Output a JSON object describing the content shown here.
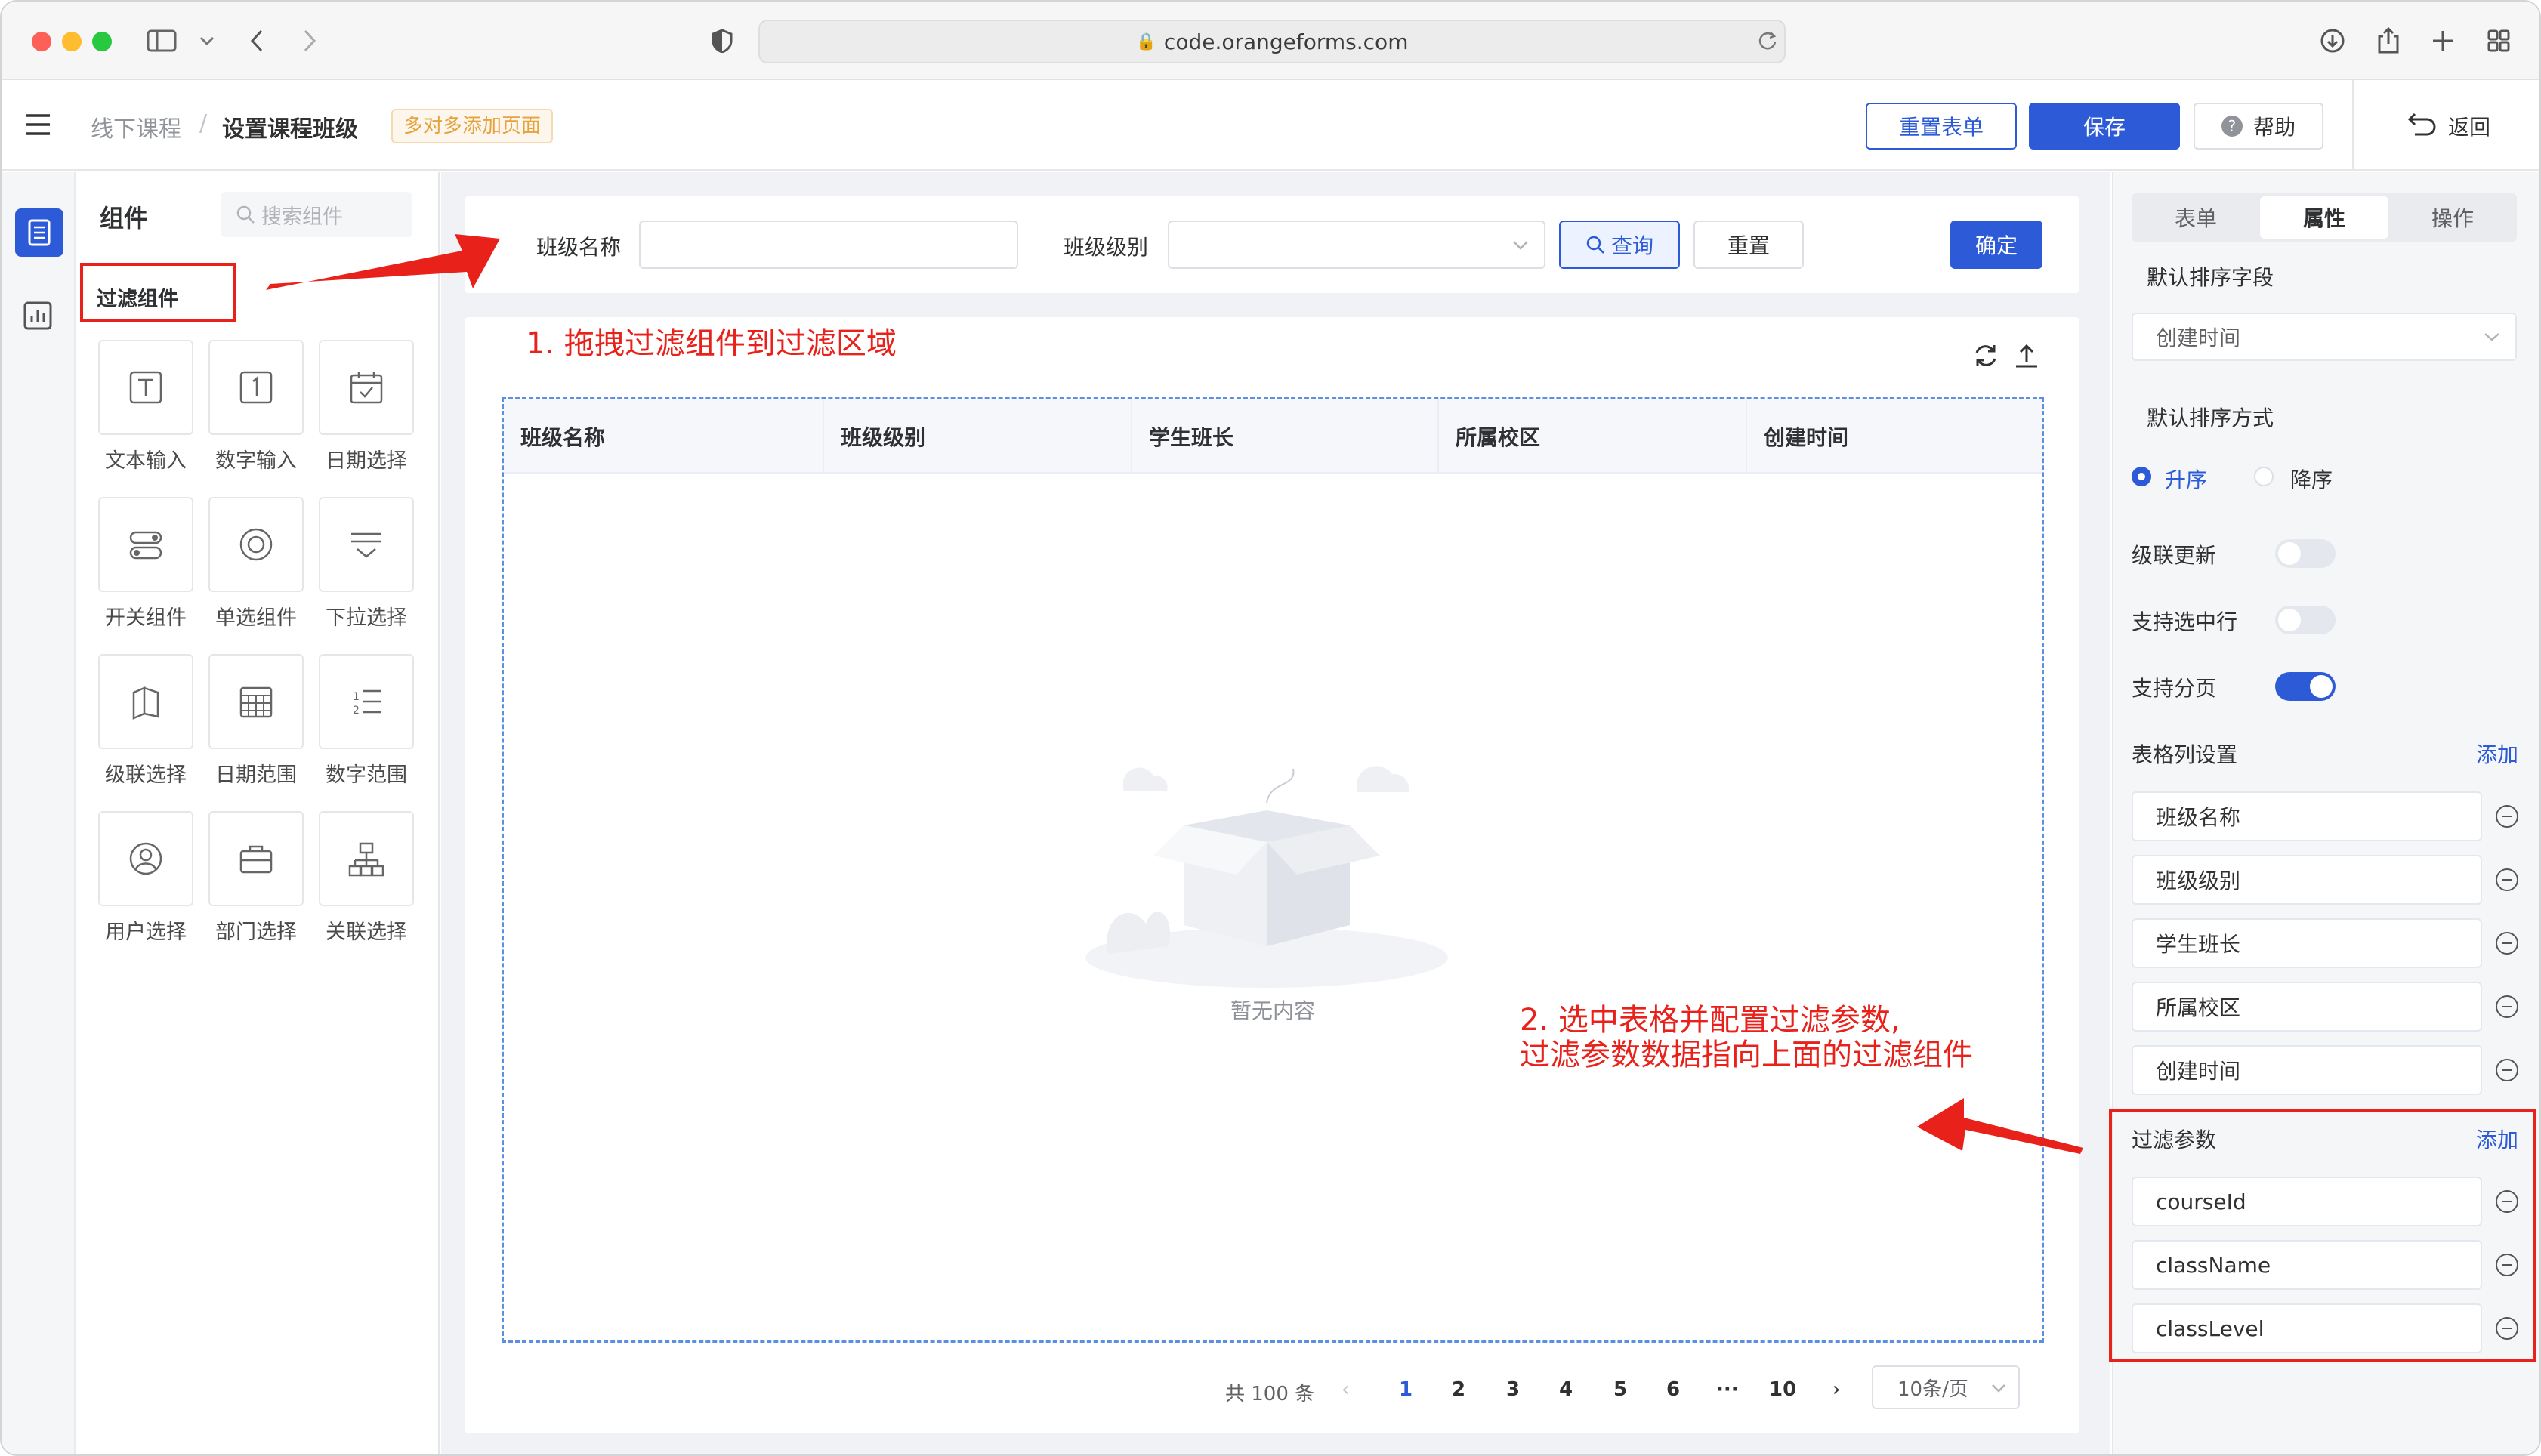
{
  "browser": {
    "url": "code.orangeforms.com"
  },
  "header": {
    "breadcrumb": [
      "线下课程",
      "设置课程班级"
    ],
    "tag": "多对多添加页面",
    "reset_form_button": "重置表单",
    "save_button": "保存",
    "help_button": "帮助",
    "back_button": "返回"
  },
  "palette": {
    "title": "组件",
    "search_placeholder": "搜索组件",
    "section_title": "过滤组件",
    "items": [
      {
        "label": "文本输入",
        "icon": "text-input-icon"
      },
      {
        "label": "数字输入",
        "icon": "number-input-icon"
      },
      {
        "label": "日期选择",
        "icon": "date-picker-icon"
      },
      {
        "label": "开关组件",
        "icon": "switch-icon"
      },
      {
        "label": "单选组件",
        "icon": "radio-icon"
      },
      {
        "label": "下拉选择",
        "icon": "select-icon"
      },
      {
        "label": "级联选择",
        "icon": "cascader-icon"
      },
      {
        "label": "日期范围",
        "icon": "date-range-icon"
      },
      {
        "label": "数字范围",
        "icon": "number-range-icon"
      },
      {
        "label": "用户选择",
        "icon": "user-select-icon"
      },
      {
        "label": "部门选择",
        "icon": "dept-select-icon"
      },
      {
        "label": "关联选择",
        "icon": "relation-select-icon"
      }
    ]
  },
  "filter": {
    "class_name_label": "班级名称",
    "class_level_label": "班级级别",
    "query_button": "查询",
    "reset_button": "重置",
    "confirm_button": "确定"
  },
  "table": {
    "columns": [
      "班级名称",
      "班级级别",
      "学生班长",
      "所属校区",
      "创建时间"
    ],
    "empty_text": "暂无内容"
  },
  "pagination": {
    "total": "共 100 条",
    "pages": [
      "1",
      "2",
      "3",
      "4",
      "5",
      "6",
      "···",
      "10"
    ],
    "current": "1",
    "page_size": "10条/页"
  },
  "annotations": {
    "step1": "1. 拖拽过滤组件到过滤区域",
    "step2_line1": "2. 选中表格并配置过滤参数,",
    "step2_line2": "过滤参数数据指向上面的过滤组件"
  },
  "right_panel": {
    "tabs": [
      "表单",
      "属性",
      "操作"
    ],
    "active_tab": "属性",
    "default_sort_field_label": "默认排序字段",
    "default_sort_field_value": "创建时间",
    "default_sort_order_label": "默认排序方式",
    "sort_asc": "升序",
    "sort_desc": "降序",
    "cascade_update_label": "级联更新",
    "cascade_update": false,
    "select_row_label": "支持选中行",
    "select_row": false,
    "paging_label": "支持分页",
    "paging": true,
    "column_settings_label": "表格列设置",
    "add_link": "添加",
    "columns": [
      "班级名称",
      "班级级别",
      "学生班长",
      "所属校区",
      "创建时间"
    ],
    "filter_params_label": "过滤参数",
    "filter_params": [
      "courseId",
      "className",
      "classLevel"
    ]
  },
  "colors": {
    "primary": "#2d5bd8",
    "annotation": "#e8221b"
  }
}
